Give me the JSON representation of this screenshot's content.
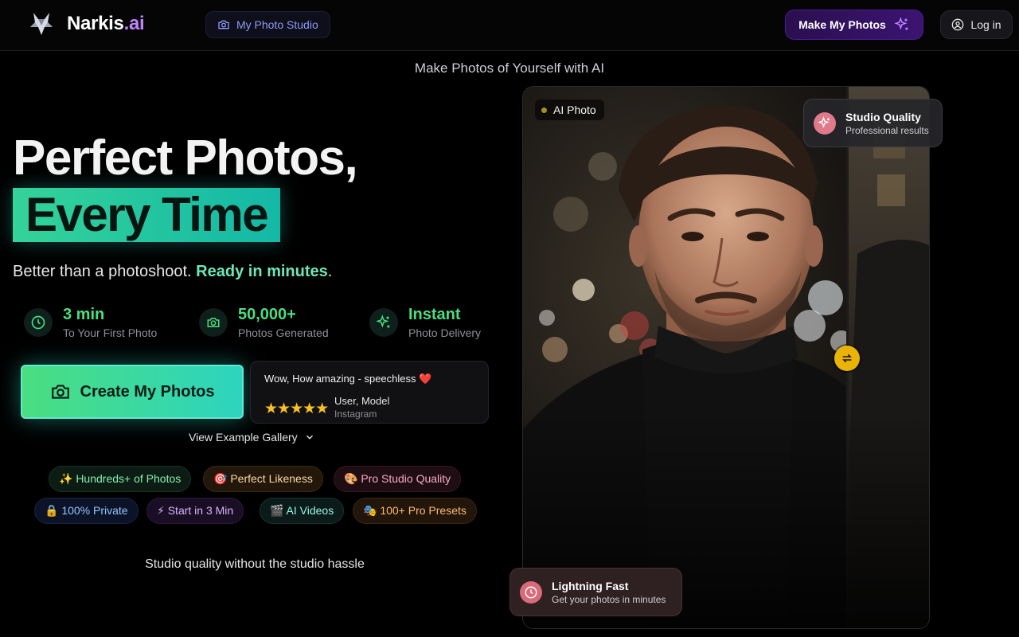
{
  "header": {
    "logo_name": "Narkis",
    "logo_suffix": ".ai",
    "studio_link": "My Photo Studio",
    "make_button": "Make My Photos",
    "login_button": "Log in"
  },
  "tagline": "Make Photos of Yourself with AI",
  "hero": {
    "line1": "Perfect Photos,",
    "line2": "Every Time",
    "sub_plain": "Better than a photoshoot. ",
    "sub_highlight": "Ready in minutes",
    "sub_end": "."
  },
  "stats": [
    {
      "value": "3 min",
      "label": "To Your First Photo",
      "icon": "clock-icon"
    },
    {
      "value": "50,000+",
      "label": "Photos Generated",
      "icon": "camera-icon"
    },
    {
      "value": "Instant",
      "label": "Photo Delivery",
      "icon": "sparkles-icon"
    }
  ],
  "cta": {
    "label": "Create My Photos"
  },
  "review": {
    "text": "Wow, How amazing - speechless ❤️",
    "stars": "★★★★★",
    "reviewer": "User, Model",
    "platform": "Instagram"
  },
  "gallery_link": "View Example Gallery",
  "chips": [
    {
      "label": "✨ Hundreds+ of Photos"
    },
    {
      "label": "🎯 Perfect Likeness"
    },
    {
      "label": "🎨 Pro Studio Quality"
    },
    {
      "label": "🔒 100% Private"
    },
    {
      "label": "⚡ Start in 3 Min"
    },
    {
      "label": "🎬 AI Videos"
    },
    {
      "label": "🎭 100+ Pro Presets"
    }
  ],
  "bottom_text": "Studio quality without the studio hassle",
  "photo": {
    "label": "AI Photo",
    "badge_quality_title": "Studio Quality",
    "badge_quality_sub": "Professional results",
    "badge_fast_title": "Lightning Fast",
    "badge_fast_sub": "Get your photos in minutes"
  },
  "colors": {
    "accent_green": "#4ade80",
    "accent_teal": "#2dd4bf",
    "accent_purple": "#c084fc",
    "handle_yellow": "#eab308"
  }
}
